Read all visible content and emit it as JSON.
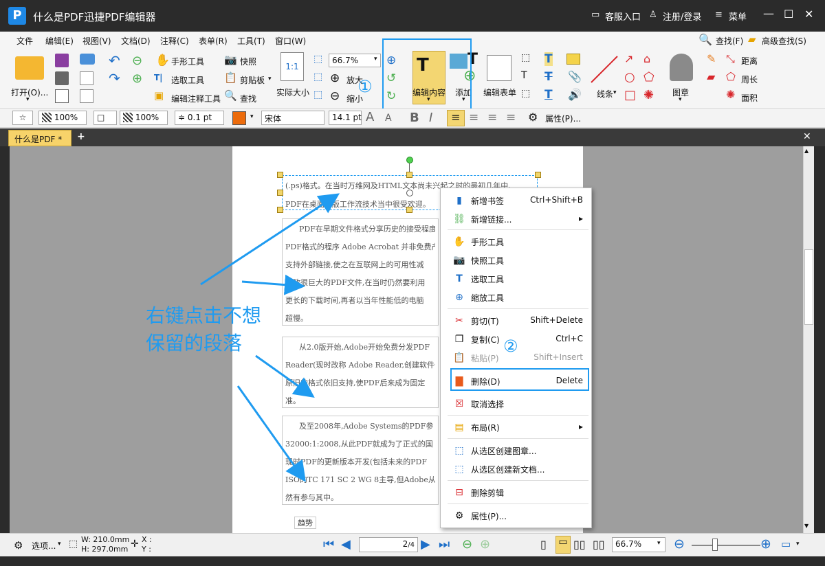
{
  "titlebar": {
    "title": "什么是PDF迅捷PDF编辑器",
    "service": "客服入口",
    "login": "注册/登录",
    "menu": "菜单"
  },
  "menubar": [
    "文件",
    "编辑(E)",
    "视图(V)",
    "文档(D)",
    "注释(C)",
    "表单(R)",
    "工具(T)",
    "窗口(W)"
  ],
  "search": {
    "find": "查找(F)",
    "advanced": "高级查找(S)"
  },
  "ribbon": {
    "open": "打开(O)...",
    "hand_tool": "手形工具",
    "select_tool": "选取工具",
    "edit_annot_tool": "编辑注释工具",
    "snapshot": "快照",
    "clipboard": "剪贴板",
    "find": "查找",
    "actual_size": "实际大小",
    "zoom_value": "66.7%",
    "zoom_in": "放大",
    "zoom_out": "缩小",
    "edit_content": "编辑内容",
    "add": "添加",
    "edit_form": "编辑表单",
    "lines": "线条",
    "stamp": "图章",
    "distance": "距离",
    "perimeter": "周长",
    "area": "面积"
  },
  "toolbar2": {
    "opacity1": "100%",
    "opacity2": "100%",
    "line_width": "0.1 pt",
    "font": "宋体",
    "font_size": "14.1 pt",
    "properties": "属性(P)..."
  },
  "tab": {
    "label": "什么是PDF *"
  },
  "document": {
    "para1": [
      "(.ps)格式。在当时万维网及HTML文本尚未兴起之时的最初几年中,",
      "PDF在桌面出版工作流技术当中很受欢迎。"
    ],
    "para2": [
      "PDF在早期文件格式分享历史的接受程度",
      "PDF格式的程序 Adobe Acrobat 并非免费产",
      "支持外部链接,使之在互联网上的可用性减",
      "导致很巨大的PDF文件,在当时仍然要利用",
      "更长的下载时间,再者以当年性能低的电脑",
      "超慢。"
    ],
    "para3": [
      "从2.0版开始,Adobe开始免费分发PDF",
      "Reader(现时改称 Adobe Reader,创建软件依",
      "原旧的格式依旧支持,使PDF后来成为固定",
      "准。"
    ],
    "para4": [
      "及至2008年,Adobe Systems的PDF参",
      "32000:1:2008,从此PDF就成为了正式的国",
      "现时PDF的更新版本开发(包括未来的PDF",
      "ISO的TC 171 SC 2 WG 8主导,但Adobe从",
      "然有参与其中。"
    ],
    "footer_word": "趋势"
  },
  "annotation": {
    "text": "右键点击不想保留的段落",
    "line1": "右键点击不想",
    "line2": "保留的段落",
    "step1": "①",
    "step2": "②",
    "color": "#1f9bf0"
  },
  "context_menu": [
    {
      "label": "新增书签",
      "shortcut": "Ctrl+Shift+B",
      "icon": "bookmark-add-icon"
    },
    {
      "label": "新增链接...",
      "shortcut": "▸",
      "icon": "link-add-icon"
    },
    {
      "label": "手形工具",
      "shortcut": "",
      "icon": "hand-icon"
    },
    {
      "label": "快照工具",
      "shortcut": "",
      "icon": "camera-icon"
    },
    {
      "label": "选取工具",
      "shortcut": "",
      "icon": "select-text-icon"
    },
    {
      "label": "缩放工具",
      "shortcut": "",
      "icon": "zoom-icon"
    },
    {
      "label": "剪切(T)",
      "shortcut": "Shift+Delete",
      "icon": "scissors-icon"
    },
    {
      "label": "复制(C)",
      "shortcut": "Ctrl+C",
      "icon": "copy-icon"
    },
    {
      "label": "粘贴(P)",
      "shortcut": "Shift+Insert",
      "icon": "paste-icon"
    },
    {
      "label": "删除(D)",
      "shortcut": "Delete",
      "icon": "trash-icon"
    },
    {
      "label": "取消选择",
      "shortcut": "",
      "icon": "deselect-icon"
    },
    {
      "label": "布局(R)",
      "shortcut": "▸",
      "icon": "layout-icon"
    },
    {
      "label": "从选区创建图章...",
      "shortcut": "",
      "icon": "stamp-create-icon"
    },
    {
      "label": "从选区创建新文档...",
      "shortcut": "",
      "icon": "doc-create-icon"
    },
    {
      "label": "删除剪辑",
      "shortcut": "",
      "icon": "clip-delete-icon"
    },
    {
      "label": "属性(P)...",
      "shortcut": "",
      "icon": "properties-icon"
    }
  ],
  "status": {
    "options": "选项...",
    "width": "W: 210.0mm",
    "height": "H: 297.0mm",
    "x": "X :",
    "y": "Y :",
    "page_current": "2",
    "page_total": "/4",
    "zoom": "66.7%"
  }
}
